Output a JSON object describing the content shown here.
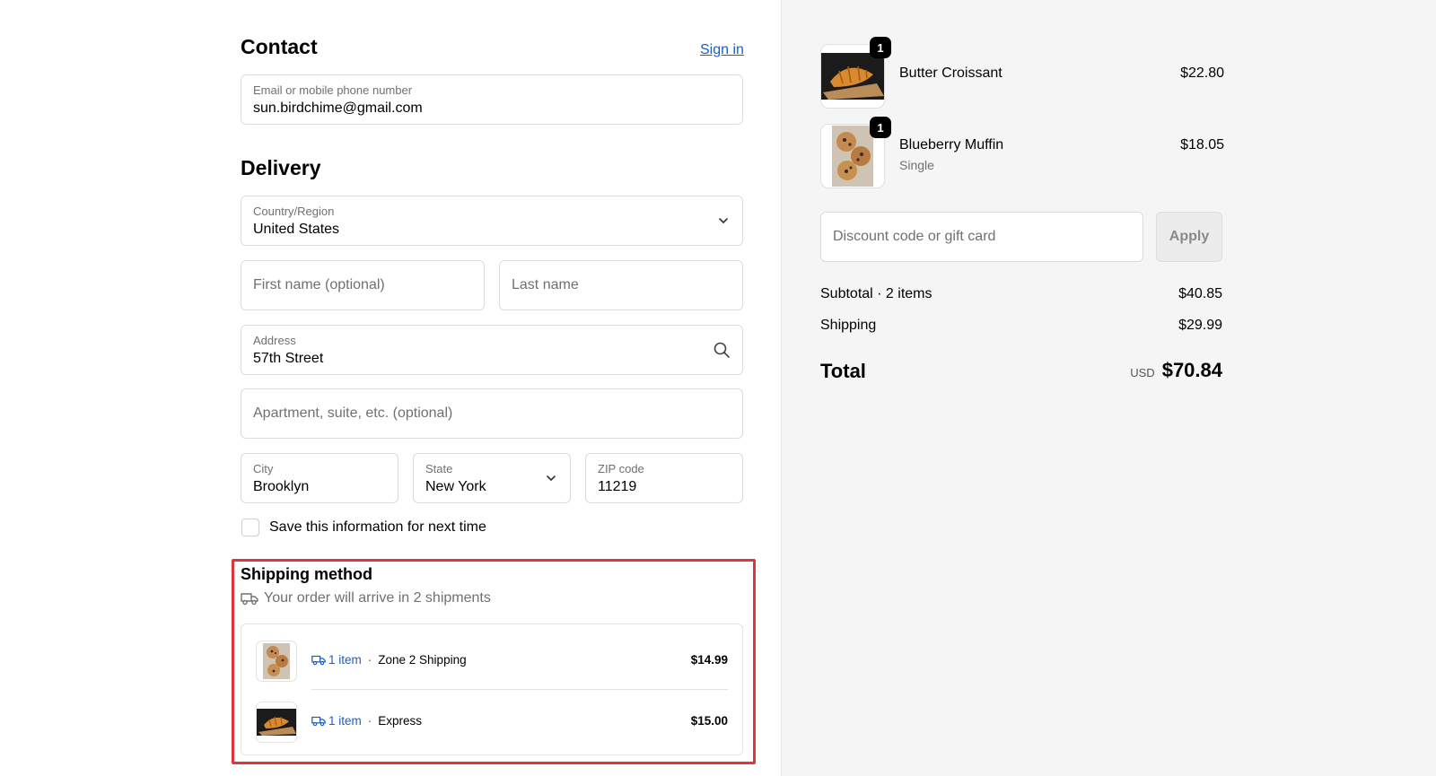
{
  "contact": {
    "title": "Contact",
    "signin_label": "Sign in",
    "email_label": "Email or mobile phone number",
    "email_value": "sun.birdchime@gmail.com"
  },
  "delivery": {
    "title": "Delivery",
    "country_label": "Country/Region",
    "country_value": "United States",
    "first_name_placeholder": "First name (optional)",
    "last_name_placeholder": "Last name",
    "address_label": "Address",
    "address_value": "57th Street",
    "apartment_placeholder": "Apartment, suite, etc. (optional)",
    "city_label": "City",
    "city_value": "Brooklyn",
    "state_label": "State",
    "state_value": "New York",
    "zip_label": "ZIP code",
    "zip_value": "11219",
    "save_info_label": "Save this information for next time"
  },
  "shipping_method": {
    "title": "Shipping method",
    "subtitle": "Your order will arrive in 2 shipments",
    "shipments": [
      {
        "items": "1 item",
        "method": "Zone 2 Shipping",
        "price": "$14.99",
        "thumb": "muffin"
      },
      {
        "items": "1 item",
        "method": "Express",
        "price": "$15.00",
        "thumb": "croissant"
      }
    ]
  },
  "order": {
    "products": [
      {
        "name": "Butter Croissant",
        "variant": "",
        "price": "$22.80",
        "qty": "1"
      },
      {
        "name": "Blueberry Muffin",
        "variant": "Single",
        "price": "$18.05",
        "qty": "1"
      }
    ],
    "discount_placeholder": "Discount code or gift card",
    "apply_label": "Apply",
    "subtotal_label": "Subtotal · 2 items",
    "subtotal_value": "$40.85",
    "shipping_label": "Shipping",
    "shipping_value": "$29.99",
    "total_label": "Total",
    "total_currency": "USD",
    "total_value": "$70.84"
  },
  "colors": {
    "link": "#1a5fc7",
    "highlight": "#e0353b",
    "sidebar_bg": "#f5f5f5"
  }
}
